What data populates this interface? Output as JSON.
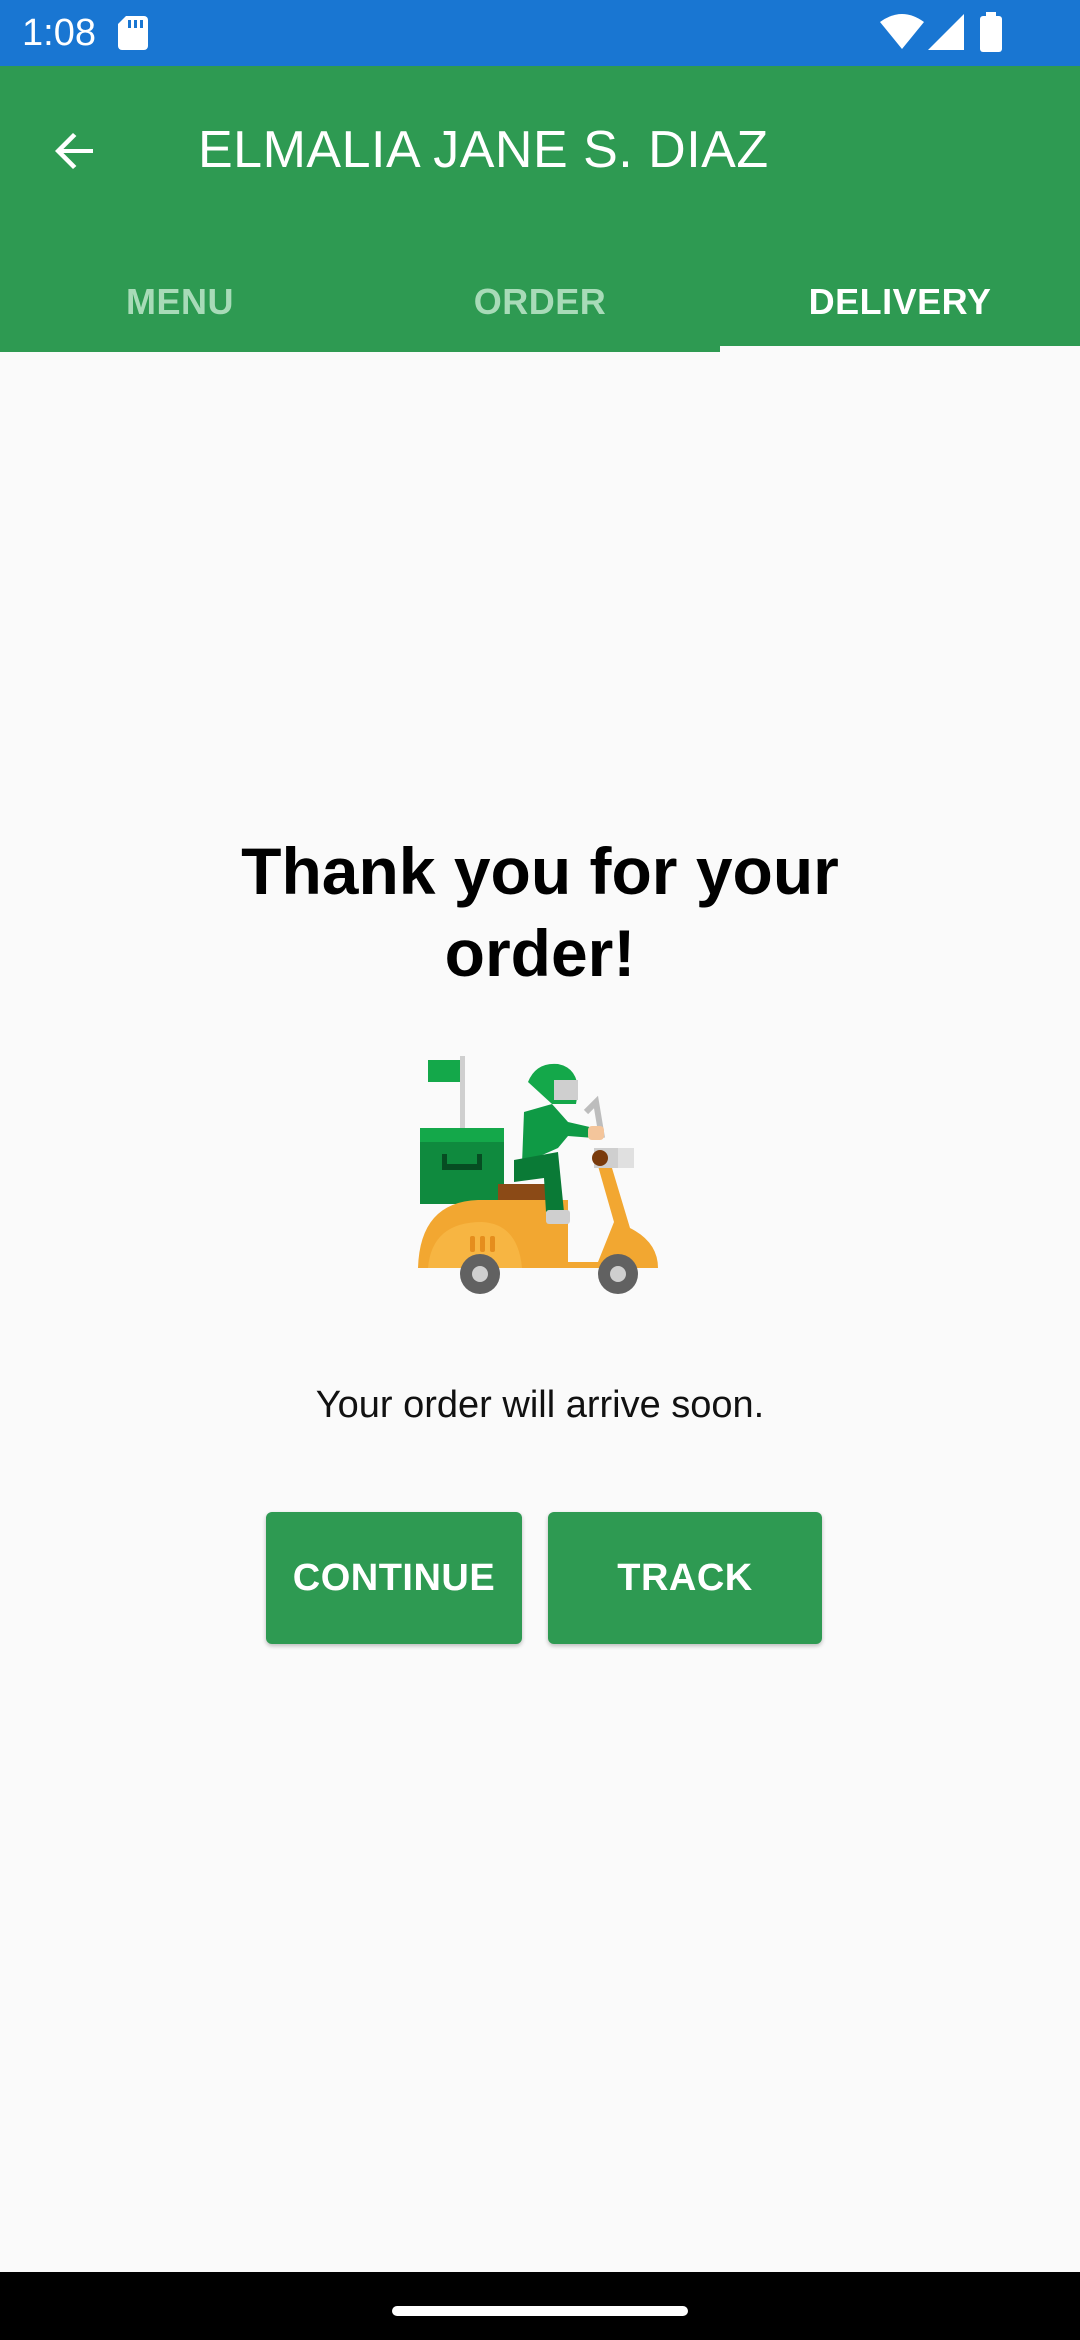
{
  "status_bar": {
    "time": "1:08",
    "color": "#1976d2",
    "icons": [
      "sd-card-icon",
      "wifi-icon",
      "cell-signal-icon",
      "battery-icon"
    ]
  },
  "app_bar": {
    "title": "ELMALIA JANE S. DIAZ",
    "back_icon": "arrow-back-icon",
    "color": "#2e9a52"
  },
  "tabs": [
    {
      "label": "MENU",
      "active": false
    },
    {
      "label": "ORDER",
      "active": false
    },
    {
      "label": "DELIVERY",
      "active": true
    }
  ],
  "main": {
    "heading": "Thank you for your order!",
    "illustration": "delivery-scooter-icon",
    "subtext": "Your order will arrive soon.",
    "buttons": {
      "continue": "CONTINUE",
      "track": "TRACK"
    }
  }
}
